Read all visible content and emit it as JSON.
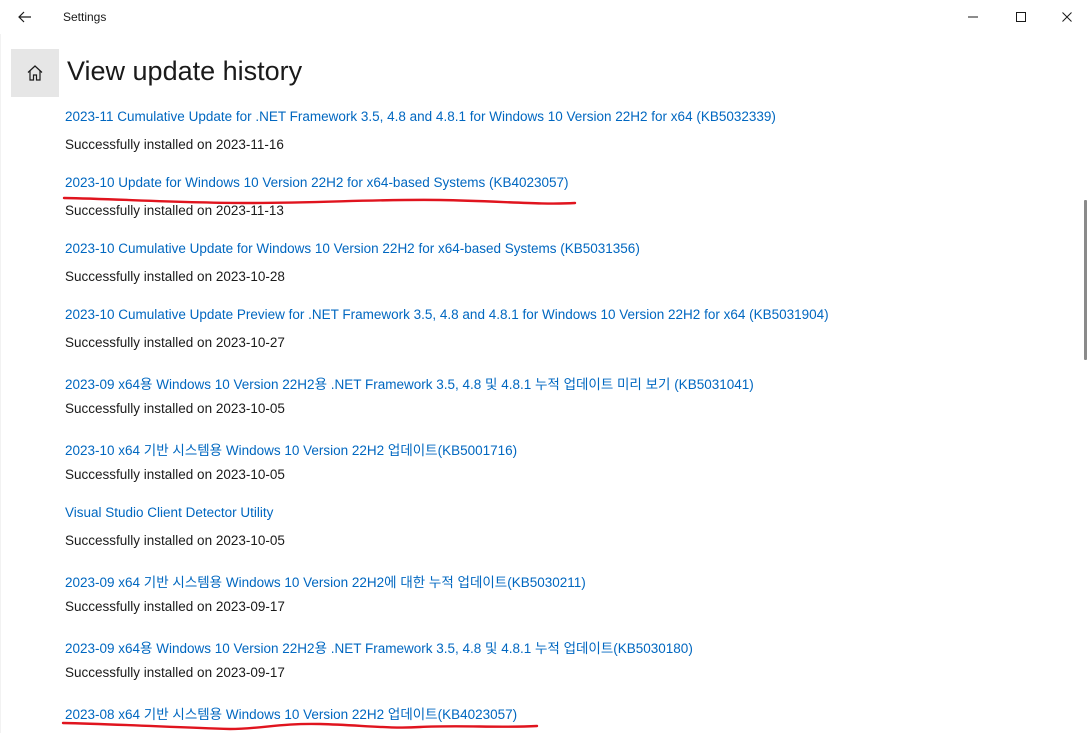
{
  "window": {
    "app_title": "Settings",
    "back_icon": "back-arrow-icon",
    "minimize_icon": "minimize-icon",
    "maximize_icon": "maximize-icon",
    "close_icon": "close-icon"
  },
  "page": {
    "home_icon": "home-icon",
    "title": "View update history"
  },
  "updates": [
    {
      "title": "2023-11 Cumulative Update for .NET Framework 3.5, 4.8 and 4.8.1 for Windows 10 Version 22H2 for x64 (KB5032339)",
      "status": "Successfully installed on 2023-11-16"
    },
    {
      "title": "2023-10 Update for Windows 10 Version 22H2 for x64-based Systems (KB4023057)",
      "status": "Successfully installed on 2023-11-13"
    },
    {
      "title": "2023-10 Cumulative Update for Windows 10 Version 22H2 for x64-based Systems (KB5031356)",
      "status": "Successfully installed on 2023-10-28"
    },
    {
      "title": "2023-10 Cumulative Update Preview for .NET Framework 3.5, 4.8 and 4.8.1 for Windows 10 Version 22H2 for x64 (KB5031904)",
      "status": "Successfully installed on 2023-10-27"
    },
    {
      "title": "2023-09 x64용 Windows 10 Version 22H2용 .NET Framework 3.5, 4.8 및 4.8.1 누적 업데이트 미리 보기 (KB5031041)",
      "status": "Successfully installed on 2023-10-05"
    },
    {
      "title": "2023-10 x64 기반 시스템용 Windows 10 Version 22H2 업데이트(KB5001716)",
      "status": "Successfully installed on 2023-10-05"
    },
    {
      "title": "Visual Studio Client Detector Utility",
      "status": "Successfully installed on 2023-10-05"
    },
    {
      "title": "2023-09 x64 기반 시스템용 Windows 10 Version 22H2에 대한 누적 업데이트(KB5030211)",
      "status": "Successfully installed on 2023-09-17"
    },
    {
      "title": "2023-09 x64용 Windows 10 Version 22H2용 .NET Framework 3.5, 4.8 및 4.8.1 누적 업데이트(KB5030180)",
      "status": "Successfully installed on 2023-09-17"
    },
    {
      "title": "2023-08 x64 기반 시스템용 Windows 10 Version 22H2 업데이트(KB4023057)",
      "status": ""
    }
  ],
  "colors": {
    "link": "#0067c0",
    "annotation": "#e0141e"
  }
}
